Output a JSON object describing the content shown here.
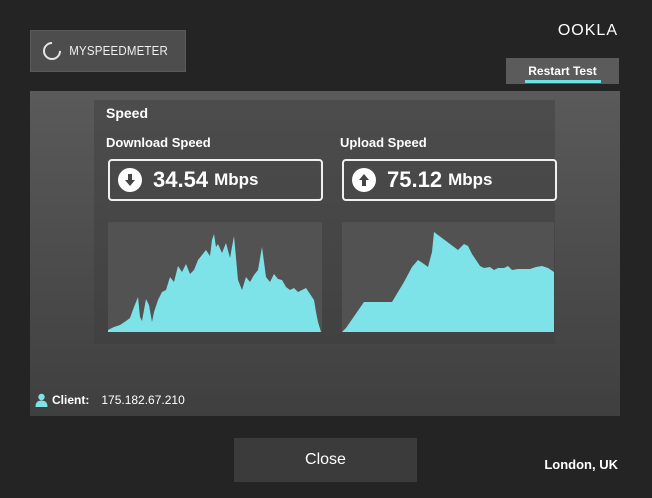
{
  "header": {
    "logo_text": "MYSPEEDMETER",
    "brand": "OOKLA",
    "restart_label": "Restart Test"
  },
  "speed": {
    "title": "Speed",
    "download": {
      "label": "Download Speed",
      "value": "34.54",
      "unit": "Mbps"
    },
    "upload": {
      "label": "Upload Speed",
      "value": "75.12",
      "unit": "Mbps"
    }
  },
  "client": {
    "label": "Client:",
    "ip": "175.182.67.210"
  },
  "footer": {
    "close_label": "Close",
    "location": "London, UK"
  },
  "colors": {
    "accent": "#7ee3e8",
    "background": "#242424",
    "panel": "#4f4f4f"
  }
}
